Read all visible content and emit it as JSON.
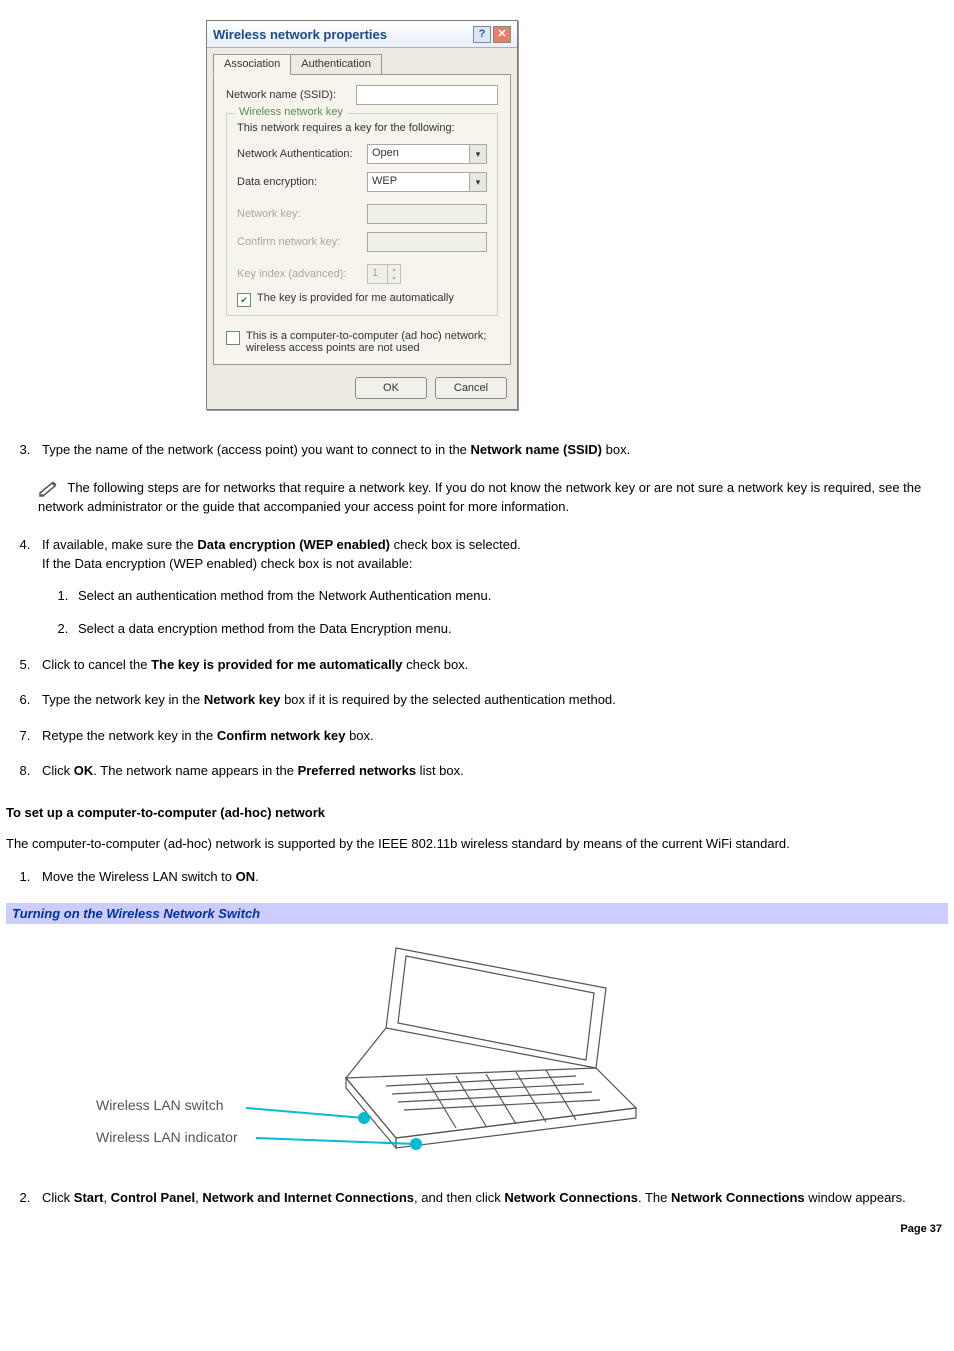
{
  "dialog": {
    "title": "Wireless network properties",
    "tab_assoc": "Association",
    "tab_auth": "Authentication",
    "ssid_label": "Network name (SSID):",
    "ssid_value": "",
    "wkey_legend": "Wireless network key",
    "wkey_intro": "This network requires a key for the following:",
    "auth_label": "Network Authentication:",
    "auth_value": "Open",
    "enc_label": "Data encryption:",
    "enc_value": "WEP",
    "netkey_label": "Network key:",
    "conf_label": "Confirm network key:",
    "keyidx_label": "Key index (advanced):",
    "keyidx_value": "1",
    "auto_chk": "The key is provided for me automatically",
    "adhoc_chk": "This is a computer-to-computer (ad hoc) network; wireless access points are not used",
    "btn_ok": "OK",
    "btn_cancel": "Cancel"
  },
  "steps": {
    "s3_a": "Type the name of the network (access point) you want to connect to in the ",
    "s3_b": "Network name (SSID)",
    "s3_c": " box.",
    "note": " The following steps are for networks that require a network key. If you do not know the network key or are not sure a network key is required, see the network administrator or the guide that accompanied your access point for more information.",
    "s4_a": "If available, make sure the ",
    "s4_b": "Data encryption (WEP enabled)",
    "s4_c": " check box is selected.",
    "s4_d": "If the Data encryption (WEP enabled) check box is not available:",
    "s4_1": "Select an authentication method from the Network Authentication menu.",
    "s4_2": "Select a data encryption method from the Data Encryption menu.",
    "s5_a": "Click to cancel the ",
    "s5_b": "The key is provided for me automatically",
    "s5_c": " check box.",
    "s6_a": "Type the network key in the ",
    "s6_b": "Network key",
    "s6_c": " box if it is required by the selected authentication method.",
    "s7_a": "Retype the network key in the ",
    "s7_b": "Confirm network key",
    "s7_c": " box.",
    "s8_a": "Click ",
    "s8_b": "OK",
    "s8_c": ". The network name appears in the ",
    "s8_d": "Preferred networks",
    "s8_e": " list box."
  },
  "adhoc": {
    "heading": "To set up a computer-to-computer (ad-hoc) network",
    "para": "The computer-to-computer (ad-hoc) network is supported by the IEEE 802.11b wireless standard by means of the current WiFi standard.",
    "s1_a": "Move the Wireless LAN switch to ",
    "s1_b": "ON",
    "s1_c": ".",
    "caption": "Turning on the Wireless Network Switch",
    "fig_switch": "Wireless LAN switch",
    "fig_indicator": "Wireless LAN indicator",
    "s2_a": "Click ",
    "s2_b": "Start",
    "s2_c": ", ",
    "s2_d": "Control Panel",
    "s2_e": ", ",
    "s2_f": "Network and Internet Connections",
    "s2_g": ", and then click ",
    "s2_h": "Network Connections",
    "s2_i": ". The ",
    "s2_j": "Network Connections",
    "s2_k": " window appears."
  },
  "page": "Page 37"
}
